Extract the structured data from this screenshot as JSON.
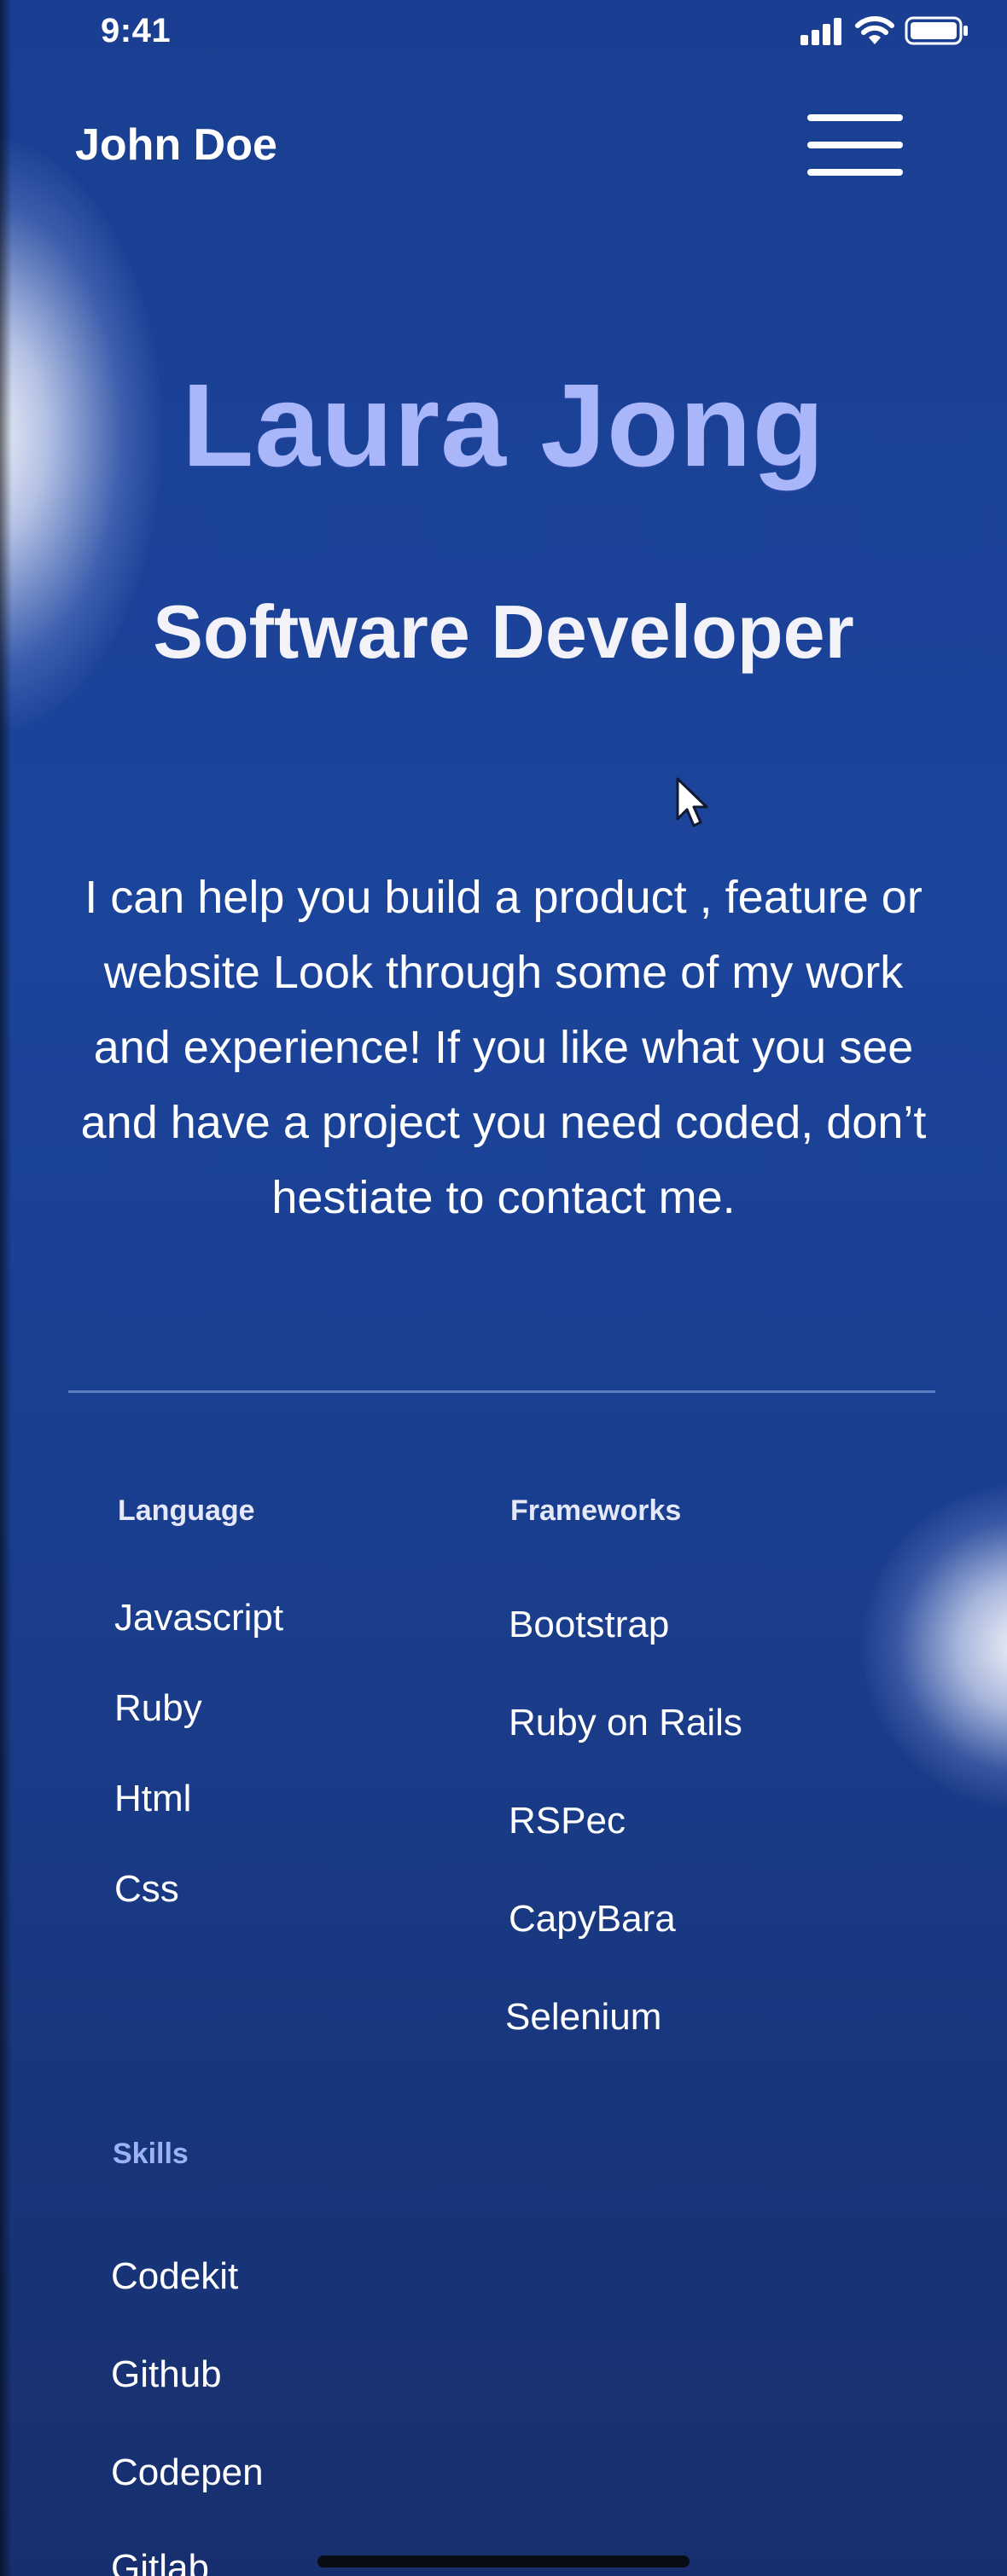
{
  "status_bar": {
    "time": "9:41",
    "icons": [
      "signal-icon",
      "wifi-icon",
      "battery-icon"
    ]
  },
  "header": {
    "brand": "John Doe",
    "menu_icon": "hamburger-menu-icon"
  },
  "hero": {
    "name": "Laura Jong",
    "role": "Software Developer",
    "description": "I can help you build a product , feature or website Look through some of my work and experience! If you like what you see and have a project you need coded,  don’t hestiate to contact me."
  },
  "language": {
    "title": "Language",
    "items": [
      "Javascript",
      "Ruby",
      "Html",
      "Css"
    ]
  },
  "frameworks": {
    "title": "Frameworks",
    "items": [
      "Bootstrap",
      "Ruby on Rails",
      "RSPec",
      "CapyBara",
      "Selenium"
    ]
  },
  "skills": {
    "title": "Skills",
    "items": [
      "Codekit",
      "Github",
      "Codepen",
      "Gitlab"
    ]
  },
  "colors": {
    "background": "#1b449b",
    "name_accent": "#a9b6f9",
    "skills_title": "#9db1f7",
    "text": "#ffffff"
  }
}
